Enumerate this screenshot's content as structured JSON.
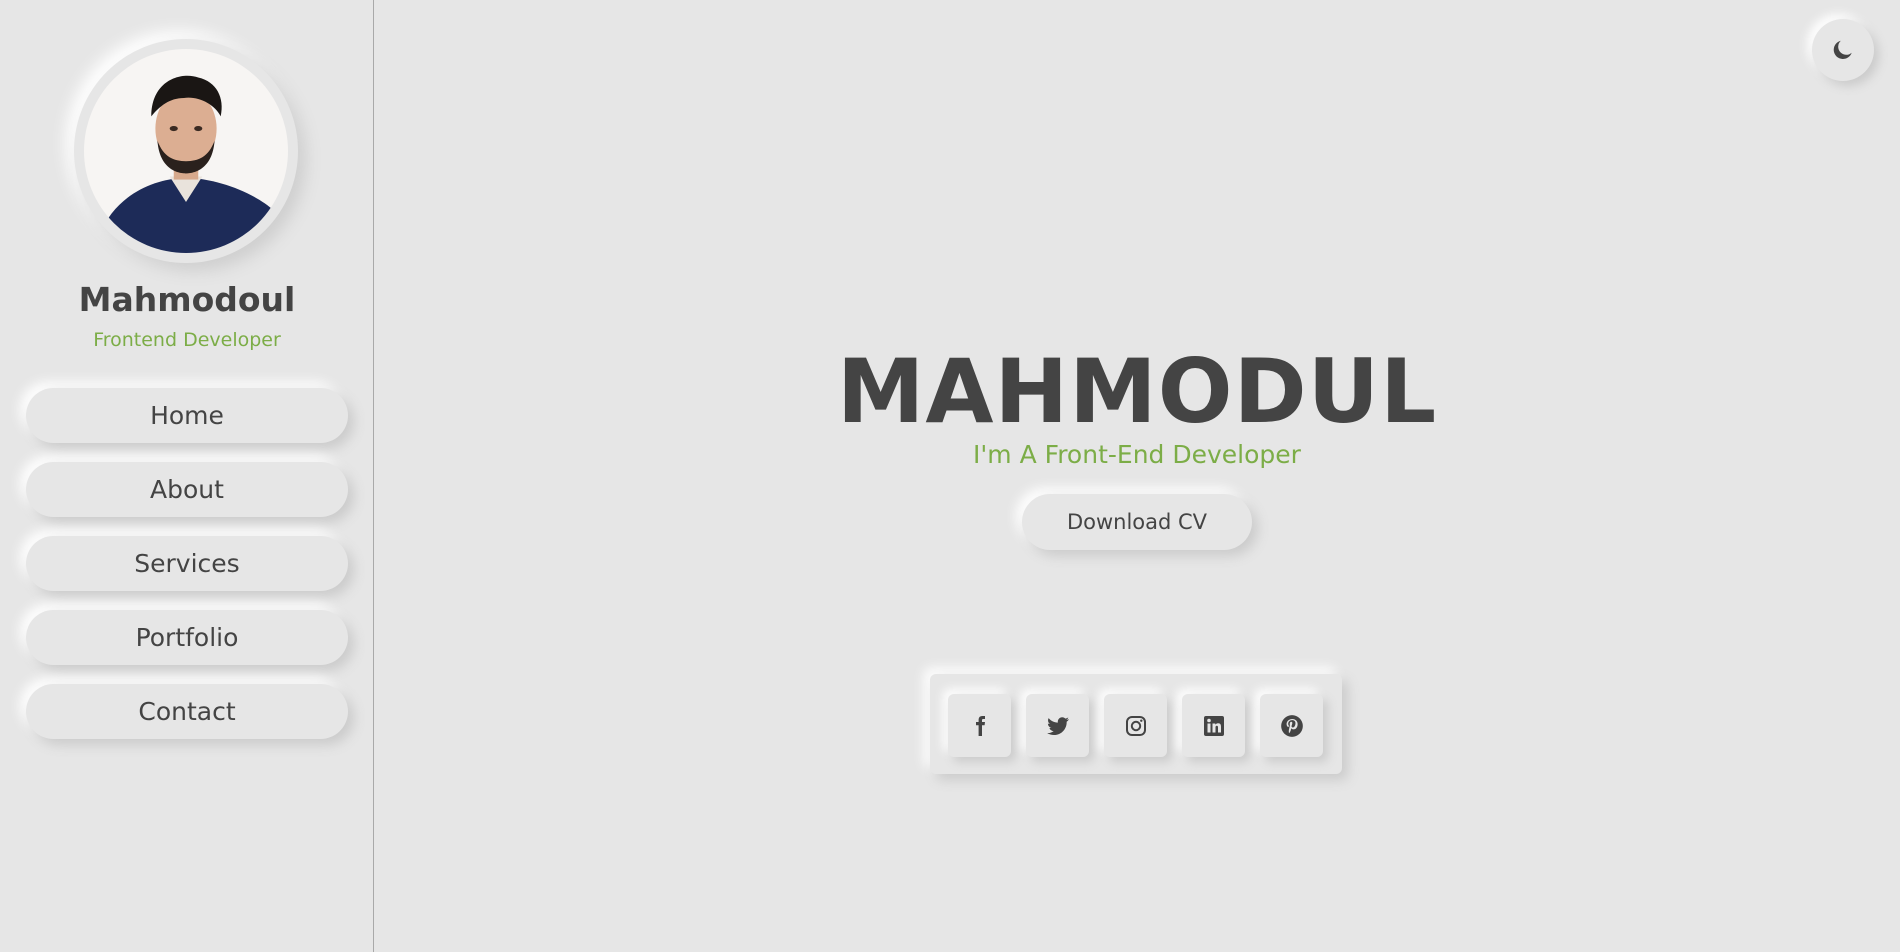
{
  "sidebar": {
    "avatar_alt": "Mahmodoul profile photo",
    "name": "Mahmodoul",
    "role": "Frontend Developer",
    "nav": [
      {
        "label": "Home"
      },
      {
        "label": "About"
      },
      {
        "label": "Services"
      },
      {
        "label": "Portfolio"
      },
      {
        "label": "Contact"
      }
    ]
  },
  "hero": {
    "title": "MAHMODUL",
    "subtitle": "I'm A Front-End Developer",
    "cv_button": "Download CV"
  },
  "social": [
    "facebook-icon",
    "twitter-icon",
    "instagram-icon",
    "linkedin-icon",
    "pinterest-icon"
  ],
  "theme_toggle_icon": "moon-icon",
  "colors": {
    "background": "#e6e6e6",
    "text": "#444444",
    "accent": "#7cad47"
  }
}
